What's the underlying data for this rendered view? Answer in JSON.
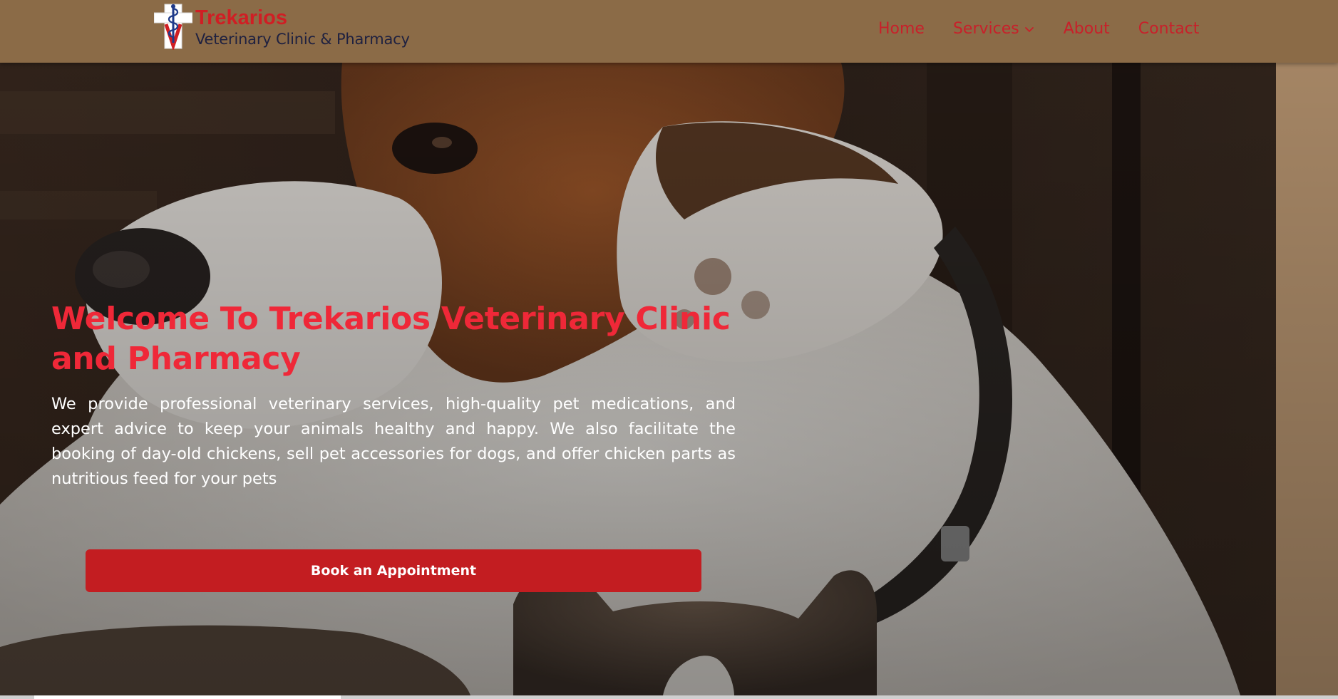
{
  "brand": {
    "name": "Trekarios",
    "tagline": "Veterinary Clinic & Pharmacy",
    "logo_icon": "caduceus-v-cross-icon"
  },
  "nav": {
    "items": [
      {
        "label": "Home"
      },
      {
        "label": "Services",
        "icon": "chevron-down-icon"
      },
      {
        "label": "About"
      },
      {
        "label": "Contact"
      }
    ]
  },
  "hero": {
    "title": "Welcome To Trekarios Veterinary Clinic and Pharmacy",
    "description": "We provide professional veterinary services, high-quality pet medications, and expert advice to keep your animals healthy and happy. We also facilitate the booking of day-old chickens, sell pet accessories for dogs, and offer chicken parts as nutritious feed for your pets",
    "cta_label": "Book an Appointment",
    "background": "dog-and-cat-photo"
  },
  "colors": {
    "navbar_bg": "#8b6b47",
    "brand_red": "#d01e24",
    "nav_link": "#c8202a",
    "title_red": "#ef2838",
    "cta_bg": "#c31d21",
    "tagline_navy": "#1f2140"
  }
}
